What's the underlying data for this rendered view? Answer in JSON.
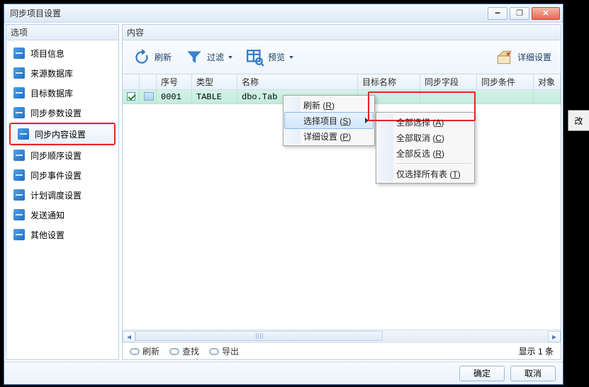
{
  "window": {
    "title": "同步项目设置"
  },
  "sidebar": {
    "header": "选项",
    "items": [
      {
        "label": "项目信息"
      },
      {
        "label": "来源数据库"
      },
      {
        "label": "目标数据库"
      },
      {
        "label": "同步参数设置"
      },
      {
        "label": "同步内容设置"
      },
      {
        "label": "同步顺序设置"
      },
      {
        "label": "同步事件设置"
      },
      {
        "label": "计划调度设置"
      },
      {
        "label": "发送通知"
      },
      {
        "label": "其他设置"
      }
    ],
    "selected_index": 4,
    "highlight_index": 4
  },
  "content": {
    "header": "内容",
    "toolbar": {
      "refresh": "刷新",
      "filter": "过滤",
      "preview": "预览",
      "detail": "详细设置"
    },
    "columns": {
      "chk": "",
      "icon": "",
      "seq": "序号",
      "type": "类型",
      "name": "名称",
      "target_name": "目标名称",
      "sync_field": "同步字段",
      "sync_cond": "同步条件",
      "object": "对象"
    },
    "rows": [
      {
        "checked": true,
        "seq": "0001",
        "type": "TABLE",
        "name": "dbo.Tab",
        "target_name": "",
        "sync_field": "",
        "sync_cond": "",
        "object": ""
      }
    ],
    "status": {
      "refresh": "刷新",
      "find": "查找",
      "export": "导出",
      "count": "显示 1 条"
    }
  },
  "footer": {
    "ok": "确定",
    "cancel": "取消"
  },
  "context_menu_1": {
    "items": [
      {
        "text": "刷新",
        "shortcut": "R"
      },
      {
        "text": "选择项目",
        "shortcut": "S",
        "submenu": true
      },
      {
        "text": "详细设置",
        "shortcut": "P"
      }
    ],
    "selected_index": 1
  },
  "context_menu_2": {
    "items": [
      {
        "text": "全部选择",
        "shortcut": "A"
      },
      {
        "text": "全部取消",
        "shortcut": "C"
      },
      {
        "text": "全部反选",
        "shortcut": "R"
      },
      {
        "sep": true
      },
      {
        "text": "仅选择所有表",
        "shortcut": "T"
      }
    ],
    "highlight_index": 0
  },
  "side_dialog": {
    "label": "改"
  }
}
